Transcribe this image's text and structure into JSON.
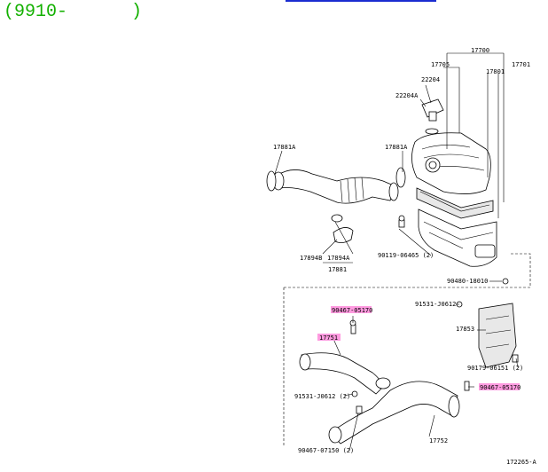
{
  "header": {
    "title": "(9910-      )",
    "accent_color": "#13b000",
    "topbar_color": "#1a2cd0"
  },
  "diagram": {
    "highlight_color": "#ff9be0",
    "labels": {
      "p17700": "17700",
      "p17705": "17705",
      "p17701": "17701",
      "p17801": "17801",
      "p22204": "22204",
      "p22204a": "22204A",
      "p17881a_left": "17881A",
      "p17881a_right": "17881A",
      "p17894b": "17894B",
      "p17894a": "17894A",
      "p17881": "17881",
      "p90119": "90119-06465 (2)",
      "p90480": "90480-18010",
      "p91531_top": "91531-J0612",
      "p17853": "17853",
      "p90179": "90179-06151 (2)",
      "p90467_top": "90467-05170",
      "p17751": "17751",
      "p91531_bottom": "91531-J0612 (2)",
      "p90467_right": "90467-05170",
      "p90467_bottom": "90467-07150 (2)",
      "p17752": "17752",
      "drawing_ref": "172265-A"
    }
  }
}
